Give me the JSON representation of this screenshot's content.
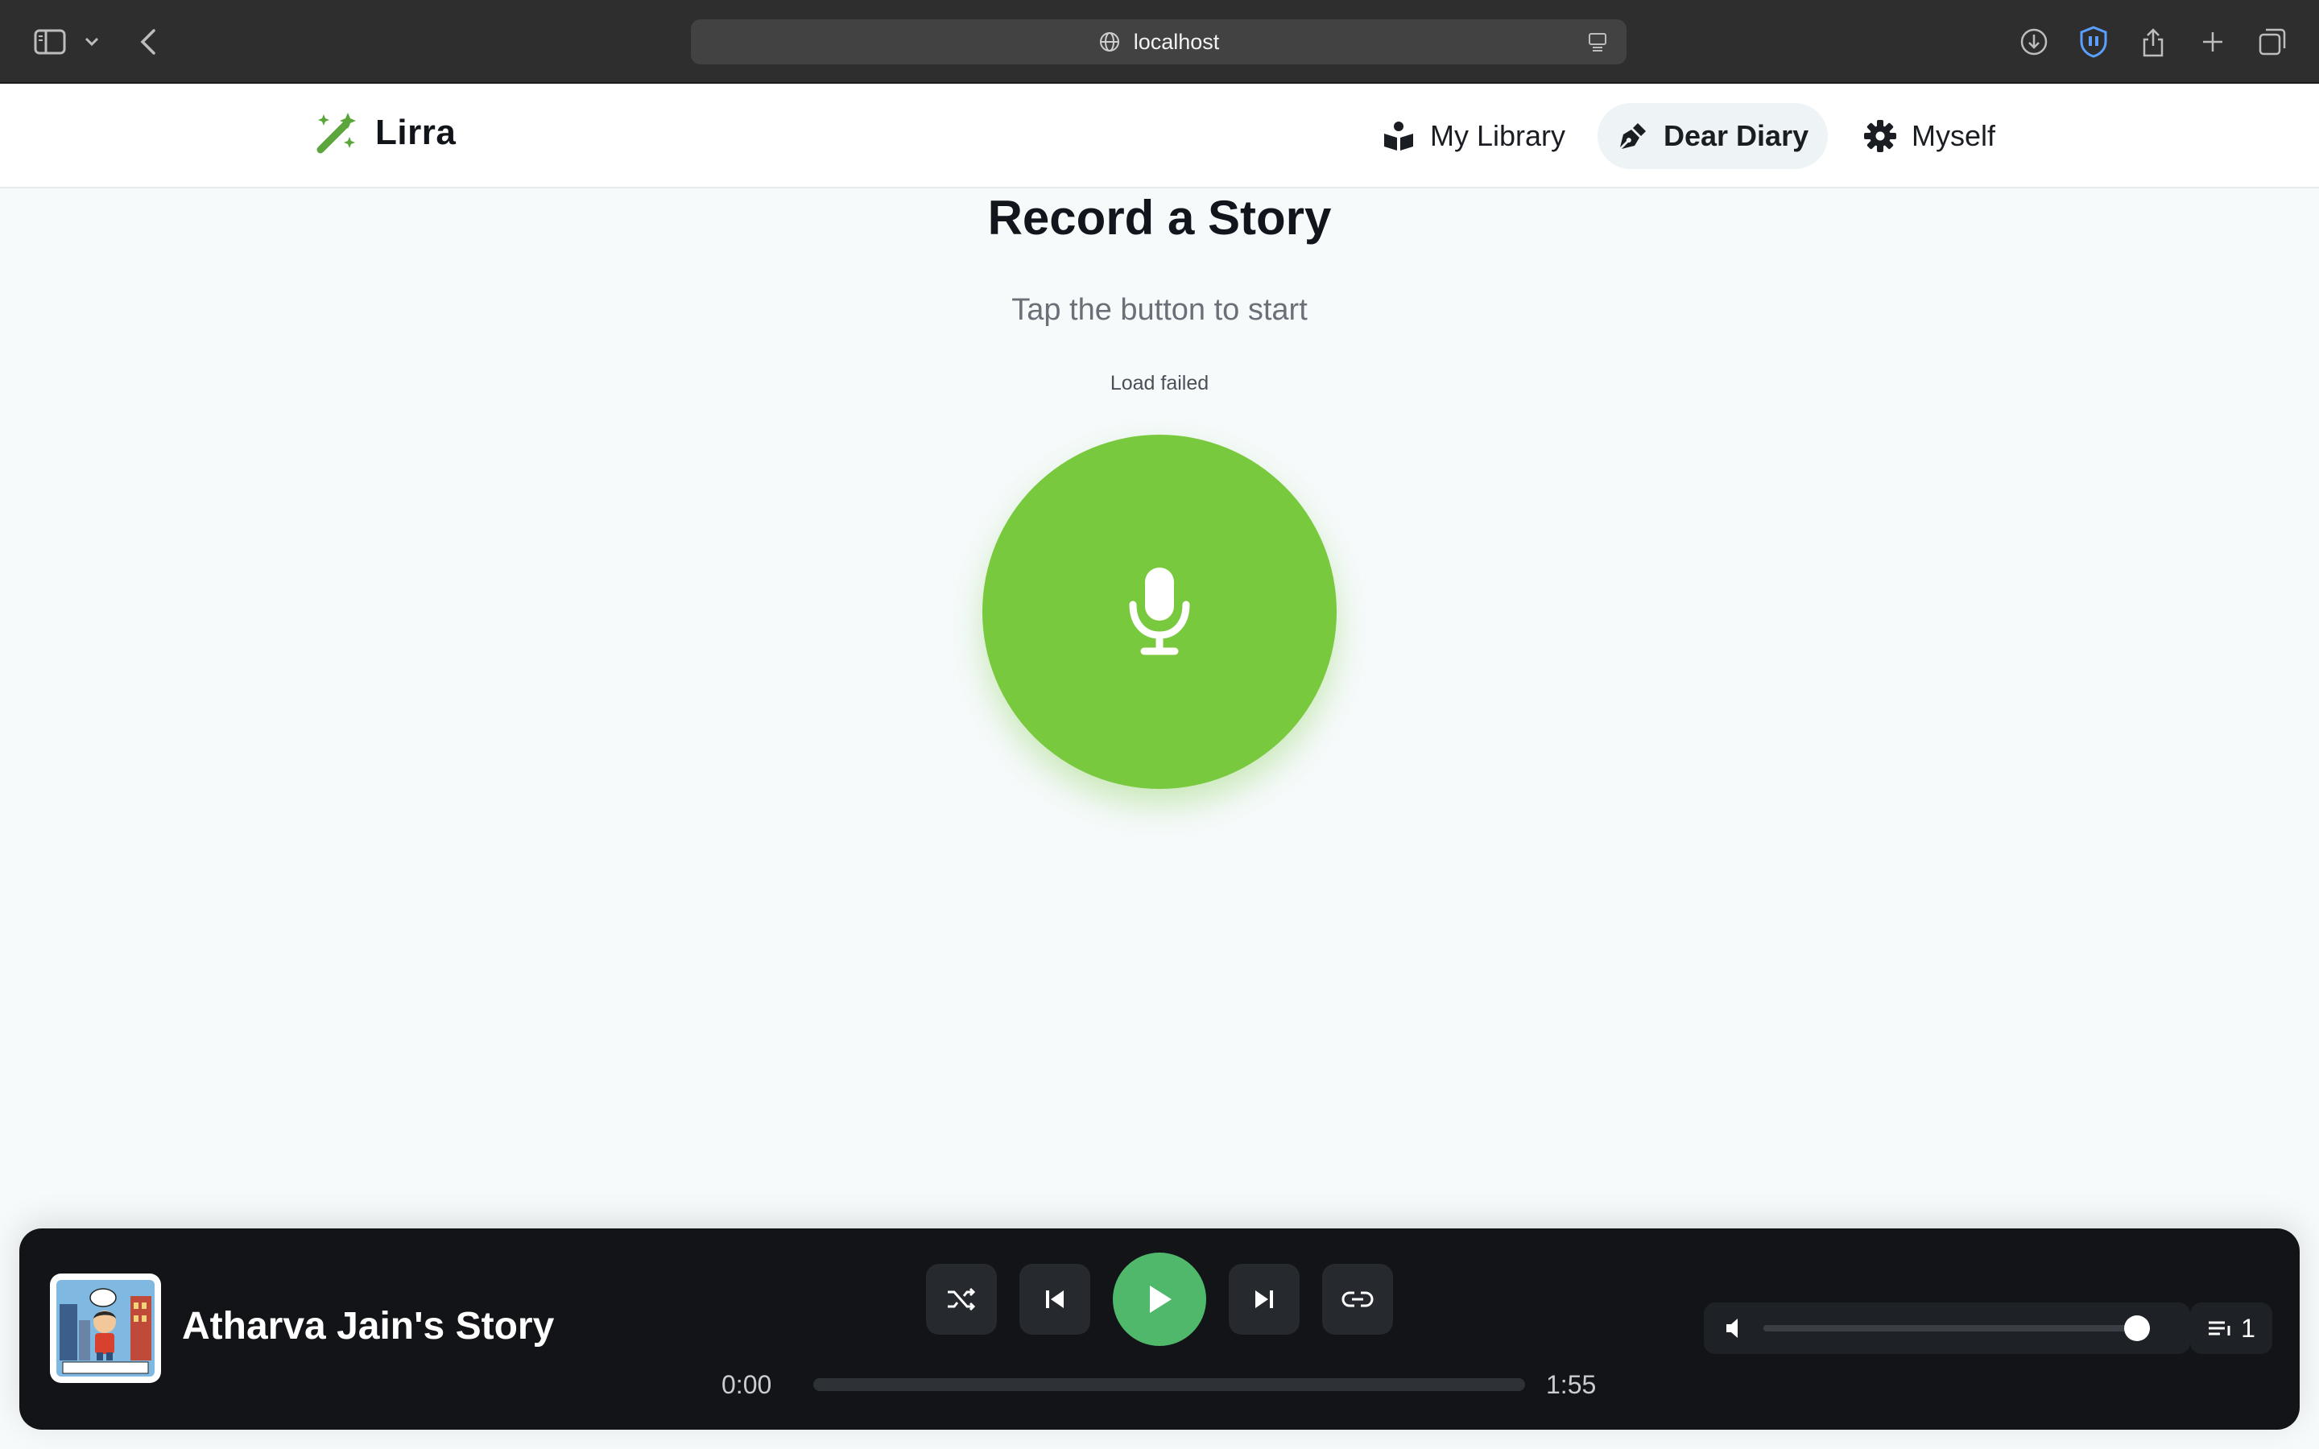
{
  "browser": {
    "url": "localhost"
  },
  "header": {
    "brand": "Lirra",
    "nav": [
      {
        "label": "My Library",
        "icon": "book-reader-icon",
        "active": false
      },
      {
        "label": "Dear Diary",
        "icon": "pen-nib-icon",
        "active": true
      },
      {
        "label": "Myself",
        "icon": "gear-icon",
        "active": false
      }
    ]
  },
  "main": {
    "title": "Record a Story",
    "subtitle": "Tap the button to start",
    "status": "Load failed",
    "record_icon": "microphone-icon"
  },
  "player": {
    "track_title": "Atharva Jain's Story",
    "cover_caption": "ONCE UPON A TIME",
    "current_time": "0:00",
    "duration": "1:55",
    "progress": 0.0,
    "volume": 1.0,
    "queue_count": "1"
  },
  "colors": {
    "brand_green": "#5aa63c",
    "record_green": "#79c93e",
    "play_green": "#4fb86a",
    "player_bg": "#121417",
    "chrome_bg": "#2e2e2f"
  }
}
